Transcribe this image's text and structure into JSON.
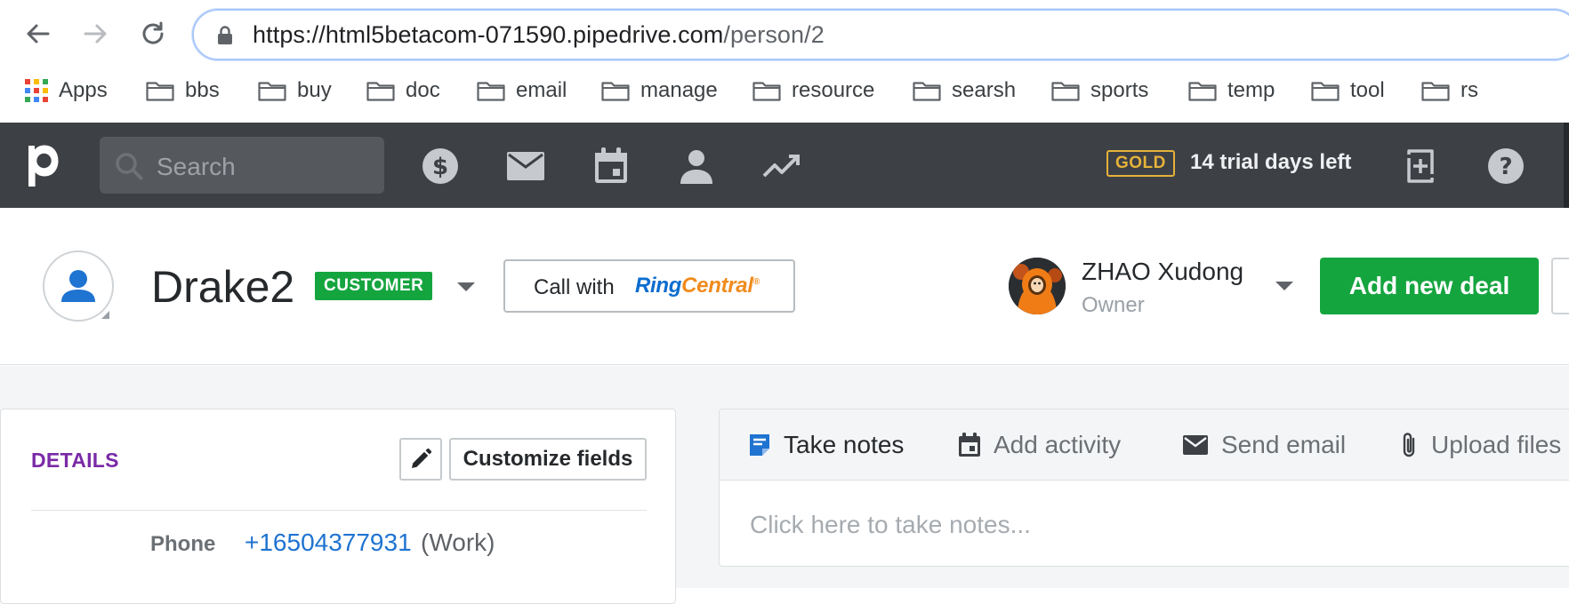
{
  "browser": {
    "url_host": "https://html5betacom-071590.pipedrive.com",
    "url_path": "/person/2",
    "bookmarks": [
      "Apps",
      "bbs",
      "buy",
      "doc",
      "email",
      "manage",
      "resource",
      "searsh",
      "sports",
      "temp",
      "tool",
      "rs"
    ]
  },
  "appbar": {
    "search_placeholder": "Search",
    "plan_badge": "GOLD",
    "trial_text": "14 trial days left",
    "nav_icons": [
      "dollar-icon",
      "mail-icon",
      "calendar-icon",
      "person-icon",
      "trend-icon"
    ]
  },
  "person": {
    "name": "Drake2",
    "label": "CUSTOMER",
    "call_with": "Call with",
    "call_provider_ring": "Ring",
    "call_provider_central": "Central",
    "owner_name": "ZHAO Xudong",
    "owner_role": "Owner",
    "add_deal": "Add new deal"
  },
  "details": {
    "title": "DETAILS",
    "customize": "Customize fields",
    "phone_label": "Phone",
    "phone_value": "+16504377931",
    "phone_type": "(Work)"
  },
  "notes": {
    "tabs": [
      "Take notes",
      "Add activity",
      "Send email",
      "Upload files"
    ],
    "placeholder": "Click here to take notes..."
  },
  "colors": {
    "appbar": "#3d4045",
    "accent_green": "#15a53f",
    "gold": "#e6b23a",
    "details_title": "#7a2aa6",
    "link_blue": "#1f73d1"
  }
}
